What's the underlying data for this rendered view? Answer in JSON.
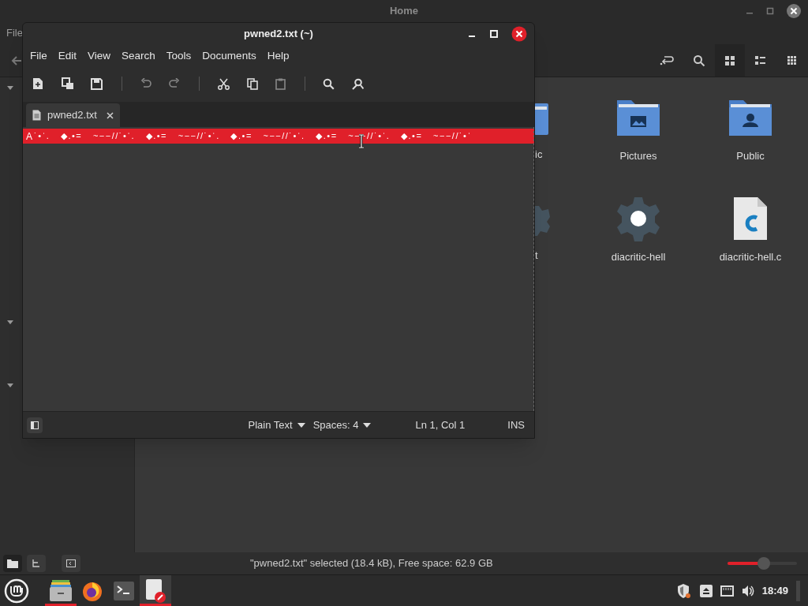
{
  "file_manager": {
    "title": "Home",
    "menu": [
      "File"
    ],
    "sidebar_sections": [
      {
        "expanded": true
      },
      {
        "expanded": true
      },
      {
        "expanded": true
      }
    ],
    "items": [
      {
        "kind": "partial-folder",
        "label": "ic"
      },
      {
        "kind": "folder-pictures",
        "label": "Pictures"
      },
      {
        "kind": "folder-public",
        "label": "Public"
      },
      {
        "kind": "partial-gear",
        "label": "t"
      },
      {
        "kind": "executable",
        "label": "diacritic-hell"
      },
      {
        "kind": "c-file",
        "label": "diacritic-hell.c"
      }
    ],
    "status": "\"pwned2.txt\" selected (18.4 kB), Free space: 62.9 GB",
    "zoom": {
      "level": 0.52
    }
  },
  "editor": {
    "title": "pwned2.txt (~)",
    "menu": [
      "File",
      "Edit",
      "View",
      "Search",
      "Tools",
      "Documents",
      "Help"
    ],
    "tabs": [
      {
        "label": "pwned2.txt",
        "selected": true
      }
    ],
    "line": {
      "first": "A",
      "rest": "˙•ˈ.   ◆.•=   ~−−//˙•ˈ.   ◆.•=   ~−−//˙•ˈ.   ◆.•=   ~−−//˙•ˈ.   ◆.•=   ~−−//˙•ˈ.   ◆.•=   ~−−//˙•ˈ",
      "selected": true
    },
    "status": {
      "language": "Plain Text",
      "indent": "Spaces: 4",
      "position": "Ln 1, Col 1",
      "mode": "INS"
    }
  },
  "taskbar": {
    "apps": [
      {
        "kind": "files",
        "running": true
      },
      {
        "kind": "firefox",
        "running": false
      },
      {
        "kind": "terminal",
        "running": false
      },
      {
        "kind": "editor",
        "running": true
      }
    ],
    "clock": "18:49"
  }
}
